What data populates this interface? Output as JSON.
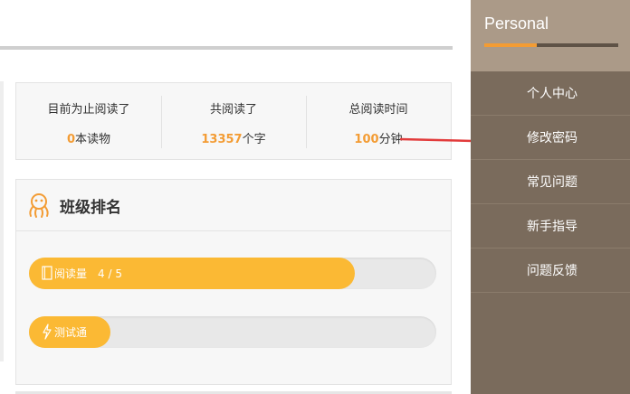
{
  "stats": [
    {
      "label": "目前为止阅读了",
      "value": "0",
      "unit": "本读物"
    },
    {
      "label": "共阅读了",
      "value": "13357",
      "unit": "个字"
    },
    {
      "label": "总阅读时间",
      "value": "100",
      "unit": "分钟"
    }
  ],
  "ranking": {
    "title": "班级排名",
    "icon": "octopus-icon",
    "bars": [
      {
        "label": "阅读量",
        "value": "4 / 5",
        "icon": "book-icon",
        "fill_percent": 80
      },
      {
        "label": "测试通",
        "value": "",
        "icon": "lightning-icon",
        "fill_percent": 20
      }
    ]
  },
  "sidebar": {
    "title": "Personal",
    "items": [
      {
        "label": "个人中心"
      },
      {
        "label": "修改密码"
      },
      {
        "label": "常见问题"
      },
      {
        "label": "新手指导"
      },
      {
        "label": "问题反馈"
      }
    ]
  },
  "colors": {
    "accent": "#f39c34",
    "bar_fill": "#fbb934",
    "sidebar_bg": "#7a6b5c",
    "sidebar_head": "#ab9a88",
    "annotation_arrow": "#e23b3b"
  }
}
